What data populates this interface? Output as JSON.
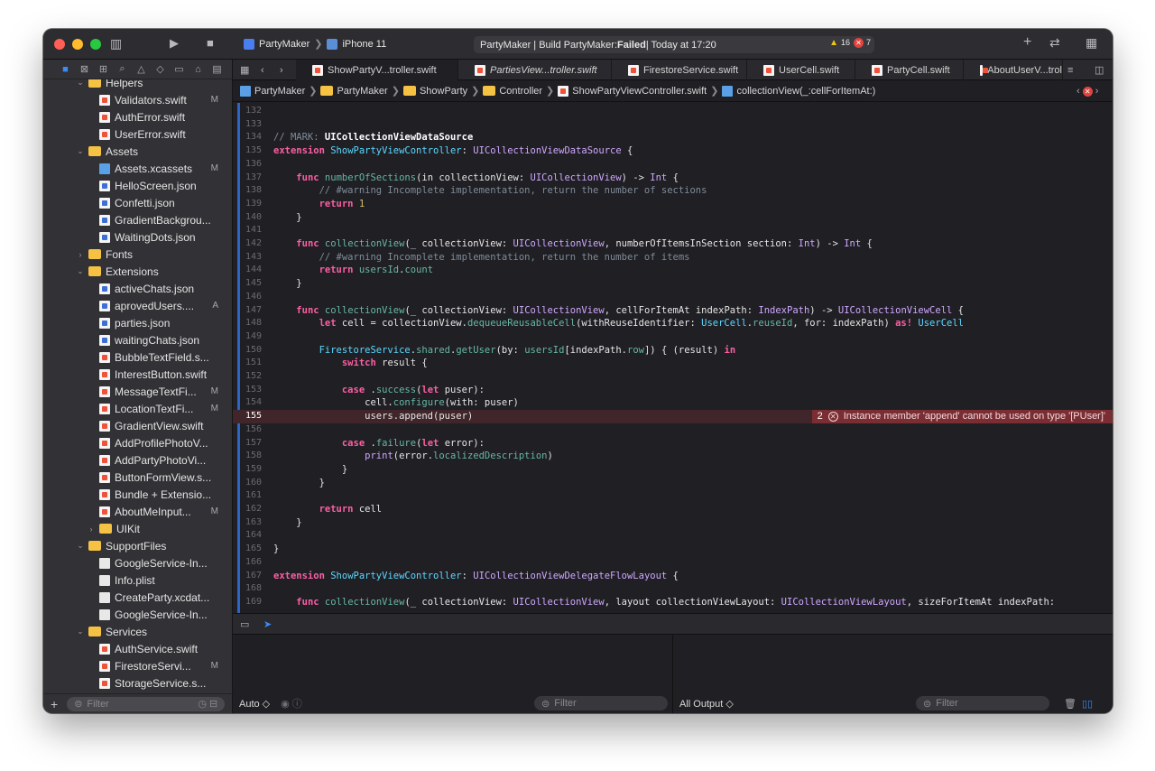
{
  "titlebar": {
    "scheme": "PartyMaker",
    "device": "iPhone 11",
    "status_prefix": "PartyMaker | Build PartyMaker: ",
    "status_result": "Failed",
    "status_suffix": " | Today at 17:20",
    "warnings": "16",
    "errors": "7"
  },
  "tree": [
    {
      "label": "Helpers",
      "kind": "folder",
      "indent": 1,
      "chev": "open",
      "badge": ""
    },
    {
      "label": "Validators.swift",
      "kind": "swift",
      "indent": 2,
      "chev": "",
      "badge": "M"
    },
    {
      "label": "AuthError.swift",
      "kind": "swift",
      "indent": 2,
      "chev": "",
      "badge": ""
    },
    {
      "label": "UserError.swift",
      "kind": "swift",
      "indent": 2,
      "chev": "",
      "badge": ""
    },
    {
      "label": "Assets",
      "kind": "folder",
      "indent": 1,
      "chev": "open",
      "badge": ""
    },
    {
      "label": "Assets.xcassets",
      "kind": "blue",
      "indent": 2,
      "chev": "",
      "badge": "M"
    },
    {
      "label": "HelloScreen.json",
      "kind": "json",
      "indent": 2,
      "chev": "",
      "badge": ""
    },
    {
      "label": "Confetti.json",
      "kind": "json",
      "indent": 2,
      "chev": "",
      "badge": ""
    },
    {
      "label": "GradientBackgrou...",
      "kind": "json",
      "indent": 2,
      "chev": "",
      "badge": ""
    },
    {
      "label": "WaitingDots.json",
      "kind": "json",
      "indent": 2,
      "chev": "",
      "badge": ""
    },
    {
      "label": "Fonts",
      "kind": "folder",
      "indent": 1,
      "chev": "closed",
      "badge": ""
    },
    {
      "label": "Extensions",
      "kind": "folder",
      "indent": 1,
      "chev": "open",
      "badge": ""
    },
    {
      "label": "activeChats.json",
      "kind": "json",
      "indent": 2,
      "chev": "",
      "badge": ""
    },
    {
      "label": "aprovedUsers....",
      "kind": "json",
      "indent": 2,
      "chev": "",
      "badge": "A"
    },
    {
      "label": "parties.json",
      "kind": "json",
      "indent": 2,
      "chev": "",
      "badge": ""
    },
    {
      "label": "waitingChats.json",
      "kind": "json",
      "indent": 2,
      "chev": "",
      "badge": ""
    },
    {
      "label": "BubbleTextField.s...",
      "kind": "swift",
      "indent": 2,
      "chev": "",
      "badge": ""
    },
    {
      "label": "InterestButton.swift",
      "kind": "swift",
      "indent": 2,
      "chev": "",
      "badge": ""
    },
    {
      "label": "MessageTextFi...",
      "kind": "swift",
      "indent": 2,
      "chev": "",
      "badge": "M"
    },
    {
      "label": "LocationTextFi...",
      "kind": "swift",
      "indent": 2,
      "chev": "",
      "badge": "M"
    },
    {
      "label": "GradientView.swift",
      "kind": "swift",
      "indent": 2,
      "chev": "",
      "badge": ""
    },
    {
      "label": "AddProfilePhotoV...",
      "kind": "swift",
      "indent": 2,
      "chev": "",
      "badge": ""
    },
    {
      "label": "AddPartyPhotoVi...",
      "kind": "swift",
      "indent": 2,
      "chev": "",
      "badge": ""
    },
    {
      "label": "ButtonFormView.s...",
      "kind": "swift",
      "indent": 2,
      "chev": "",
      "badge": ""
    },
    {
      "label": "Bundle + Extensio...",
      "kind": "swift",
      "indent": 2,
      "chev": "",
      "badge": ""
    },
    {
      "label": "AboutMeInput...",
      "kind": "swift",
      "indent": 2,
      "chev": "",
      "badge": "M"
    },
    {
      "label": "UIKit",
      "kind": "folder",
      "indent": 2,
      "chev": "closed",
      "badge": ""
    },
    {
      "label": "SupportFiles",
      "kind": "folder",
      "indent": 1,
      "chev": "open",
      "badge": ""
    },
    {
      "label": "GoogleService-In...",
      "kind": "plain",
      "indent": 2,
      "chev": "",
      "badge": ""
    },
    {
      "label": "Info.plist",
      "kind": "plain",
      "indent": 2,
      "chev": "",
      "badge": ""
    },
    {
      "label": "CreateParty.xcdat...",
      "kind": "plain",
      "indent": 2,
      "chev": "",
      "badge": ""
    },
    {
      "label": "GoogleService-In...",
      "kind": "plain",
      "indent": 2,
      "chev": "",
      "badge": ""
    },
    {
      "label": "Services",
      "kind": "folder",
      "indent": 1,
      "chev": "open",
      "badge": ""
    },
    {
      "label": "AuthService.swift",
      "kind": "swift",
      "indent": 2,
      "chev": "",
      "badge": ""
    },
    {
      "label": "FirestoreServi...",
      "kind": "swift",
      "indent": 2,
      "chev": "",
      "badge": "M"
    },
    {
      "label": "StorageService.s...",
      "kind": "swift",
      "indent": 2,
      "chev": "",
      "badge": ""
    }
  ],
  "sidebar_filter": "Filter",
  "tabs": [
    {
      "label": "ShowPartyV...troller.swift",
      "active": true,
      "italic": false
    },
    {
      "label": "PartiesView...troller.swift",
      "active": false,
      "italic": true
    },
    {
      "label": "FirestoreService.swift",
      "active": false,
      "italic": false
    },
    {
      "label": "UserCell.swift",
      "active": false,
      "italic": false
    },
    {
      "label": "PartyCell.swift",
      "active": false,
      "italic": false
    },
    {
      "label": "AboutUserV...trol",
      "active": false,
      "italic": false
    }
  ],
  "breadcrumb": [
    "PartyMaker",
    "PartyMaker",
    "ShowParty",
    "Controller",
    "ShowPartyViewController.swift",
    "collectionView(_:cellForItemAt:)"
  ],
  "code": [
    {
      "n": "132",
      "html": ""
    },
    {
      "n": "133",
      "html": ""
    },
    {
      "n": "134",
      "html": "<span class='c'>// MARK: </span><span style='color:#ffffff;font-weight:bold'>UICollectionViewDataSource</span>"
    },
    {
      "n": "135",
      "html": "<span class='k'>extension</span> <span class='ty'>ShowPartyViewController</span>: <span class='t'>UICollectionViewDataSource</span> {"
    },
    {
      "n": "136",
      "html": ""
    },
    {
      "n": "137",
      "html": "    <span class='k'>func</span> <span class='f'>numberOfSections</span>(in collectionView: <span class='t'>UICollectionView</span>) -> <span class='t'>Int</span> {"
    },
    {
      "n": "138",
      "html": "        <span class='c'>// #warning Incomplete implementation, return the number of sections</span>"
    },
    {
      "n": "139",
      "html": "        <span class='k'>return</span> <span class='n'>1</span>"
    },
    {
      "n": "140",
      "html": "    }"
    },
    {
      "n": "141",
      "html": ""
    },
    {
      "n": "142",
      "html": "    <span class='k'>func</span> <span class='f'>collectionView</span>(_ collectionView: <span class='t'>UICollectionView</span>, numberOfItemsInSection section: <span class='t'>Int</span>) -> <span class='t'>Int</span> {"
    },
    {
      "n": "143",
      "html": "        <span class='c'>// #warning Incomplete implementation, return the number of items</span>"
    },
    {
      "n": "144",
      "html": "        <span class='k'>return</span> <span class='f'>usersId</span>.<span class='f'>count</span>"
    },
    {
      "n": "145",
      "html": "    }"
    },
    {
      "n": "146",
      "html": ""
    },
    {
      "n": "147",
      "html": "    <span class='k'>func</span> <span class='f'>collectionView</span>(_ collectionView: <span class='t'>UICollectionView</span>, cellForItemAt indexPath: <span class='t'>IndexPath</span>) -> <span class='t'>UICollectionViewCell</span> {"
    },
    {
      "n": "148",
      "html": "        <span class='k'>let</span> cell = collectionView.<span class='f'>dequeueReusableCell</span>(withReuseIdentifier: <span class='ty'>UserCell</span>.<span class='f'>reuseId</span>, for: indexPath) <span class='k'>as!</span> <span class='ty'>UserCell</span>"
    },
    {
      "n": "149",
      "html": ""
    },
    {
      "n": "150",
      "html": "        <span class='ty'>FirestoreService</span>.<span class='f'>shared</span>.<span class='f'>getUser</span>(by: <span class='f'>usersId</span>[indexPath.<span class='f'>row</span>]) { (result) <span class='k'>in</span>"
    },
    {
      "n": "151",
      "html": "            <span class='k'>switch</span> result {"
    },
    {
      "n": "152",
      "html": ""
    },
    {
      "n": "153",
      "html": "            <span class='k'>case</span> .<span class='f'>success</span>(<span class='k'>let</span> puser):"
    },
    {
      "n": "154",
      "html": "                cell.<span class='f'>configure</span>(with: puser)"
    },
    {
      "n": "155",
      "html": "                users.append(puser)"
    },
    {
      "n": "156",
      "html": ""
    },
    {
      "n": "157",
      "html": "            <span class='k'>case</span> .<span class='f'>failure</span>(<span class='k'>let</span> error):"
    },
    {
      "n": "158",
      "html": "                <span class='t'>print</span>(error.<span class='f'>localizedDescription</span>)"
    },
    {
      "n": "159",
      "html": "            }"
    },
    {
      "n": "160",
      "html": "        }"
    },
    {
      "n": "161",
      "html": ""
    },
    {
      "n": "162",
      "html": "        <span class='k'>return</span> cell"
    },
    {
      "n": "163",
      "html": "    }"
    },
    {
      "n": "164",
      "html": ""
    },
    {
      "n": "165",
      "html": "}"
    },
    {
      "n": "166",
      "html": ""
    },
    {
      "n": "167",
      "html": "<span class='k'>extension</span> <span class='ty'>ShowPartyViewController</span>: <span class='t'>UICollectionViewDelegateFlowLayout</span> {"
    },
    {
      "n": "168",
      "html": ""
    },
    {
      "n": "169",
      "html": "    <span class='k'>func</span> <span class='f'>collectionView</span>(_ collectionView: <span class='t'>UICollectionView</span>, layout collectionViewLayout: <span class='t'>UICollectionViewLayout</span>, sizeForItemAt indexPath:"
    }
  ],
  "current_line": "155",
  "error": {
    "count": "2",
    "message": "Instance member 'append' cannot be used on type '[PUser]'"
  },
  "console": {
    "auto_label": "Auto ◇",
    "filter_left": "Filter",
    "output_label": "All Output ◇",
    "filter_right": "Filter"
  }
}
